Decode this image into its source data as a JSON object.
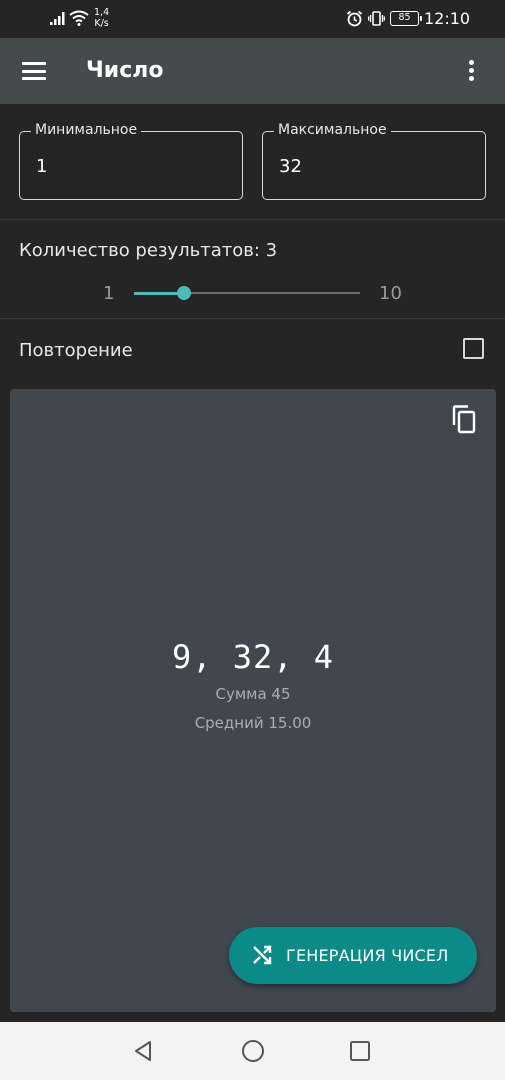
{
  "status_bar": {
    "net_speed_value": "1,4",
    "net_speed_unit": "K/s",
    "battery": "85",
    "time": "12:10",
    "icons": [
      "signal-icon",
      "wifi-icon",
      "alarm-icon",
      "vibrate-icon",
      "battery-icon"
    ]
  },
  "app_bar": {
    "title": "Число",
    "menu_icon": "menu-icon",
    "overflow_icon": "more-vert-icon"
  },
  "inputs": {
    "min_label": "Минимальное",
    "min_value": "1",
    "max_label": "Максимальное",
    "max_value": "32"
  },
  "count": {
    "label": "Количество результатов: 3",
    "slider_min": "1",
    "slider_max": "10",
    "slider_value": 3
  },
  "repeat": {
    "label": "Повторение",
    "checked": false
  },
  "result": {
    "numbers": "9, 32, 4",
    "sum": "Сумма  45",
    "average": "Средний  15.00",
    "copy_icon": "copy-icon"
  },
  "fab": {
    "label": "ГЕНЕРАЦИЯ ЧИСЕЛ",
    "icon": "shuffle-icon"
  },
  "colors": {
    "accent": "#4cbcb8",
    "fab": "#0c8a87",
    "app_bar": "#434b4c",
    "card": "#40474f",
    "background": "#252525"
  }
}
